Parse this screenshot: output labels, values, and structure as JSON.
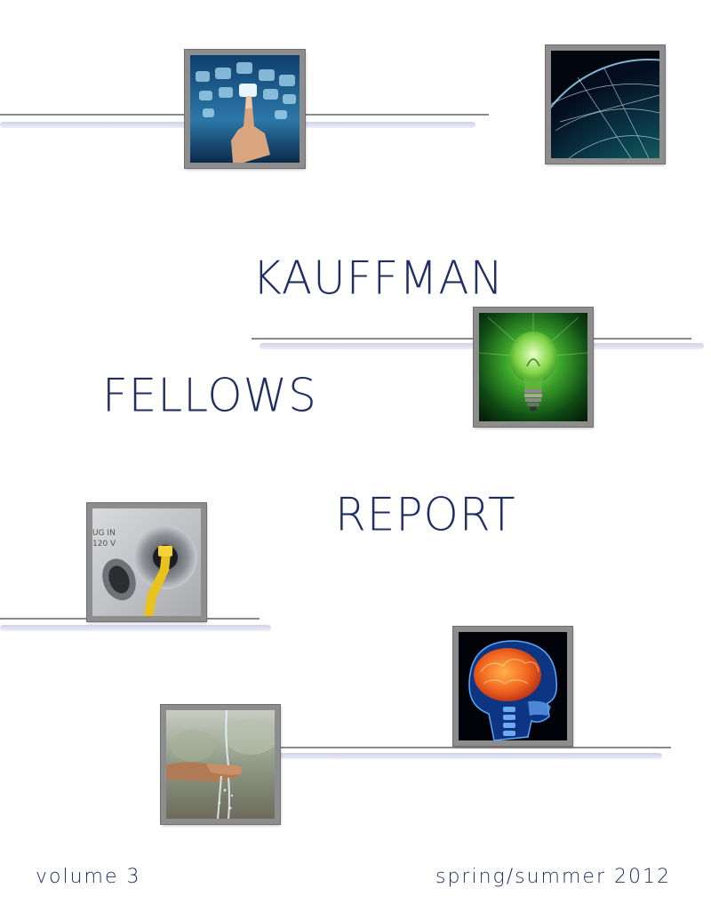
{
  "cover": {
    "title_line_1": "KAUFFMAN",
    "title_line_2": "FELLOWS",
    "title_line_3": "REPORT",
    "volume": "volume 3",
    "issue": "spring/summer 2012"
  },
  "colors": {
    "title_navy": "#1f2f63",
    "frame_gray": "#8d8d8d",
    "rule_gray": "#8a8a8a",
    "rule_shadow_lavender": "#cdd0e6"
  },
  "photos": [
    {
      "subject": "touchscreen-hand"
    },
    {
      "subject": "glowing-globe"
    },
    {
      "subject": "green-lightbulb"
    },
    {
      "subject": "electric-plug-in-port"
    },
    {
      "subject": "brain-xray"
    },
    {
      "subject": "water-in-hand"
    }
  ]
}
